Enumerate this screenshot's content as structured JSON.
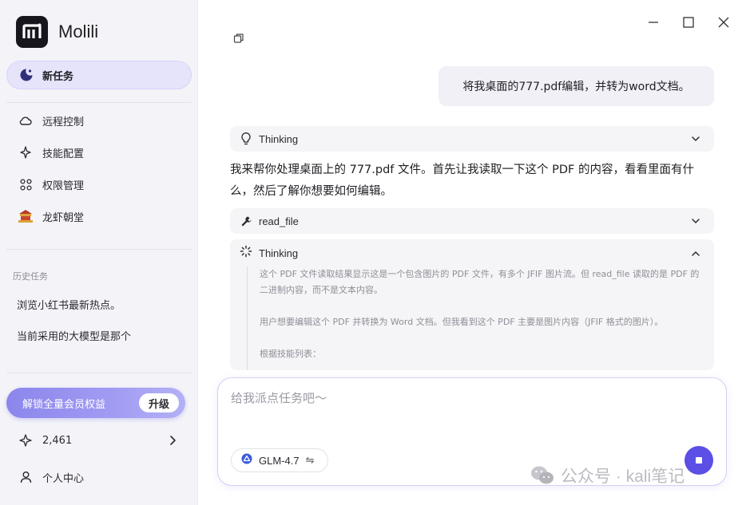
{
  "app": {
    "name": "Molili"
  },
  "sidebar": {
    "new_task": "新任务",
    "nav": [
      {
        "label": "远程控制",
        "icon": "cloud-icon"
      },
      {
        "label": "技能配置",
        "icon": "sparkle-icon"
      },
      {
        "label": "权限管理",
        "icon": "apps-grid-icon"
      },
      {
        "label": "龙虾朝堂",
        "icon": "lobster-court-icon"
      }
    ],
    "history_title": "历史任务",
    "history": [
      "浏览小红书最新热点。",
      "当前采用的大模型是那个"
    ],
    "upgrade_label": "解锁全量会员权益",
    "upgrade_button": "升级",
    "credits": "2,461",
    "profile": "个人中心"
  },
  "chat": {
    "user_message": "将我桌面的777.pdf编辑，并转为word文档。",
    "thinking_label": "Thinking",
    "answer": "我来帮你处理桌面上的 777.pdf 文件。首先让我读取一下这个 PDF 的内容，看看里面有什么，然后了解你想要如何编辑。",
    "tool_label": "read_file",
    "thinking2_label": "Thinking",
    "thinking2_lines": [
      "这个 PDF 文件读取结果显示这是一个包含图片的 PDF 文件，有多个 JFIF 图片流。但 read_file 读取的是 PDF 的二进制内容，而不是文本内容。",
      "用户想要编辑这个 PDF 并转换为 Word 文档。但我看到这个 PDF 主要是图片内容（JFIF 格式的图片）。",
      "根据技能列表："
    ]
  },
  "composer": {
    "placeholder": "给我派点任务吧～",
    "model": "GLM-4.7",
    "model_switch": "⇋"
  },
  "watermark": "公众号 · kali笔记",
  "colors": {
    "accent": "#5b4fe6",
    "sidebar_bg": "#f4f4f8",
    "new_task_bg": "#e6e4fb"
  }
}
